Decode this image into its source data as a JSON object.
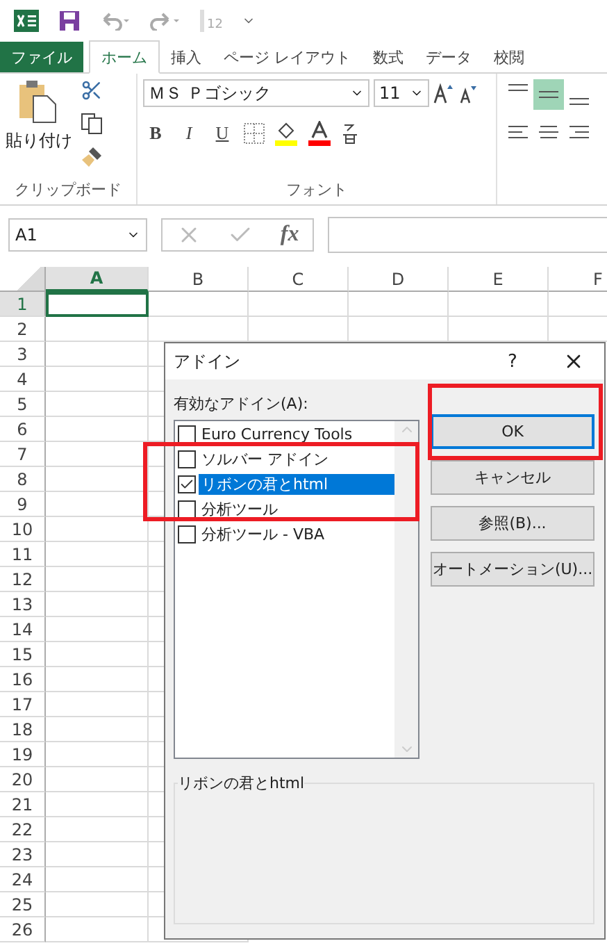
{
  "quick_access": {
    "badge": "12"
  },
  "tabs": [
    {
      "label": "ファイル",
      "kind": "file",
      "selected": false
    },
    {
      "label": "ホーム",
      "kind": "tab",
      "selected": true
    },
    {
      "label": "挿入",
      "kind": "tab",
      "selected": false
    },
    {
      "label": "ページ レイアウト",
      "kind": "tab",
      "selected": false
    },
    {
      "label": "数式",
      "kind": "tab",
      "selected": false
    },
    {
      "label": "データ",
      "kind": "tab",
      "selected": false
    },
    {
      "label": "校閲",
      "kind": "tab",
      "selected": false
    }
  ],
  "clipboard_group": {
    "paste_label": "貼り付け",
    "title": "クリップボード"
  },
  "font_group": {
    "font_name": "ＭＳ Ｐゴシック",
    "font_size": "11",
    "bold": "B",
    "italic": "I",
    "underline": "U",
    "title": "フォント"
  },
  "name_box": "A1",
  "formula_bar": {
    "fx": "fx"
  },
  "sheet": {
    "columns": [
      {
        "label": "A",
        "selected": true
      },
      {
        "label": "B",
        "selected": false
      },
      {
        "label": "C",
        "selected": false
      },
      {
        "label": "D",
        "selected": false
      },
      {
        "label": "E",
        "selected": false
      },
      {
        "label": "F",
        "selected": false
      }
    ],
    "rows": [
      {
        "label": "1",
        "selected": true
      },
      {
        "label": "2",
        "selected": false
      },
      {
        "label": "3",
        "selected": false
      },
      {
        "label": "4",
        "selected": false
      },
      {
        "label": "5",
        "selected": false
      },
      {
        "label": "6",
        "selected": false
      },
      {
        "label": "7",
        "selected": false
      },
      {
        "label": "8",
        "selected": false
      },
      {
        "label": "9",
        "selected": false
      },
      {
        "label": "10",
        "selected": false
      },
      {
        "label": "11",
        "selected": false
      },
      {
        "label": "12",
        "selected": false
      },
      {
        "label": "13",
        "selected": false
      },
      {
        "label": "14",
        "selected": false
      },
      {
        "label": "15",
        "selected": false
      },
      {
        "label": "16",
        "selected": false
      },
      {
        "label": "17",
        "selected": false
      },
      {
        "label": "18",
        "selected": false
      },
      {
        "label": "19",
        "selected": false
      },
      {
        "label": "20",
        "selected": false
      },
      {
        "label": "21",
        "selected": false
      },
      {
        "label": "22",
        "selected": false
      },
      {
        "label": "23",
        "selected": false
      },
      {
        "label": "24",
        "selected": false
      },
      {
        "label": "25",
        "selected": false
      },
      {
        "label": "26",
        "selected": false
      }
    ]
  },
  "dialog": {
    "title": "アドイン",
    "help": "?",
    "list_label": "有効なアドイン(A):",
    "addins": [
      {
        "name": "Euro Currency Tools",
        "checked": false,
        "selected": false
      },
      {
        "name": "ソルバー アドイン",
        "checked": false,
        "selected": false
      },
      {
        "name": "リボンの君とhtml",
        "checked": true,
        "selected": true
      },
      {
        "name": "分析ツール",
        "checked": false,
        "selected": false
      },
      {
        "name": "分析ツール - VBA",
        "checked": false,
        "selected": false
      }
    ],
    "buttons": [
      {
        "label": "OK",
        "default": true
      },
      {
        "label": "キャンセル",
        "default": false
      },
      {
        "label": "参照(B)...",
        "default": false
      },
      {
        "label": "オートメーション(U)...",
        "default": false
      }
    ],
    "description_title": "リボンの君とhtml"
  }
}
